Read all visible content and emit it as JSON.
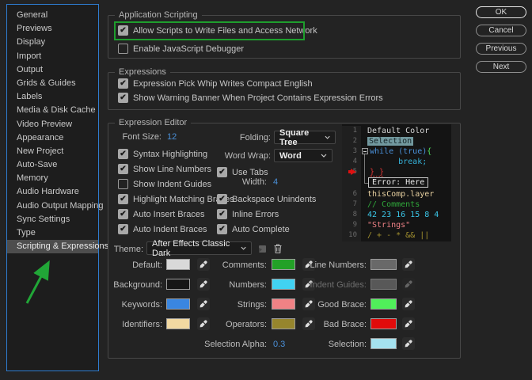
{
  "sidebar": {
    "items": [
      {
        "label": "General",
        "selected": false
      },
      {
        "label": "Previews",
        "selected": false
      },
      {
        "label": "Display",
        "selected": false
      },
      {
        "label": "Import",
        "selected": false
      },
      {
        "label": "Output",
        "selected": false
      },
      {
        "label": "Grids & Guides",
        "selected": false
      },
      {
        "label": "Labels",
        "selected": false
      },
      {
        "label": "Media & Disk Cache",
        "selected": false
      },
      {
        "label": "Video Preview",
        "selected": false
      },
      {
        "label": "Appearance",
        "selected": false
      },
      {
        "label": "New Project",
        "selected": false
      },
      {
        "label": "Auto-Save",
        "selected": false
      },
      {
        "label": "Memory",
        "selected": false
      },
      {
        "label": "Audio Hardware",
        "selected": false
      },
      {
        "label": "Audio Output Mapping",
        "selected": false
      },
      {
        "label": "Sync Settings",
        "selected": false
      },
      {
        "label": "Type",
        "selected": false
      },
      {
        "label": "Scripting & Expressions",
        "selected": true
      }
    ]
  },
  "dialog_buttons": {
    "ok": "OK",
    "cancel": "Cancel",
    "previous": "Previous",
    "next": "Next"
  },
  "application_scripting": {
    "title": "Application Scripting",
    "allow_scripts": {
      "label": "Allow Scripts to Write Files and Access Network",
      "checked": true
    },
    "enable_debugger": {
      "label": "Enable JavaScript Debugger",
      "checked": false
    }
  },
  "expressions": {
    "title": "Expressions",
    "pick_whip": {
      "label": "Expression Pick Whip Writes Compact English",
      "checked": true
    },
    "warning_banner": {
      "label": "Show Warning Banner When Project Contains Expression Errors",
      "checked": true
    }
  },
  "expression_editor": {
    "title": "Expression Editor",
    "font_size": {
      "label": "Font Size:",
      "value": "12"
    },
    "folding": {
      "label": "Folding:",
      "value": "Square Tree"
    },
    "word_wrap": {
      "label": "Word Wrap:",
      "value": "Word"
    },
    "tab_width": {
      "label": "Width:",
      "value": "4"
    },
    "checks": {
      "syntax_highlighting": {
        "label": "Syntax Highlighting",
        "checked": true
      },
      "show_line_numbers": {
        "label": "Show Line Numbers",
        "checked": true
      },
      "show_indent_guides": {
        "label": "Show Indent Guides",
        "checked": false
      },
      "highlight_matching_braces": {
        "label": "Highlight Matching Braces",
        "checked": true
      },
      "auto_insert_braces": {
        "label": "Auto Insert Braces",
        "checked": true
      },
      "auto_indent_braces": {
        "label": "Auto Indent Braces",
        "checked": true
      },
      "use_tabs": {
        "label": "Use Tabs",
        "checked": true
      },
      "backspace_unindents": {
        "label": "Backspace Unindents",
        "checked": true
      },
      "inline_errors": {
        "label": "Inline Errors",
        "checked": true
      },
      "auto_complete": {
        "label": "Auto Complete",
        "checked": true
      }
    },
    "preview": {
      "error_tooltip": "Error: Here",
      "lines": [
        {
          "num": "1",
          "tokens": [
            {
              "text": "Default Color",
              "color": "#d6d6d6"
            }
          ]
        },
        {
          "num": "2",
          "tokens": [
            {
              "text": "Selection",
              "color": "#152428"
            }
          ]
        },
        {
          "num": "3",
          "tokens": [
            {
              "text": "while (true)",
              "color": "#4a90d9"
            },
            {
              "text": "{",
              "color": "#4fdf5a"
            }
          ]
        },
        {
          "num": "4",
          "tokens": [
            {
              "text": "      break;",
              "color": "#35b1d8"
            }
          ]
        },
        {
          "num": "5",
          "tokens": [
            {
              "text": "} }",
              "color": "#d63333"
            }
          ]
        },
        {
          "num": "6",
          "tokens": [
            {
              "text": "thisComp.layer",
              "color": "#e6cf9f"
            }
          ]
        },
        {
          "num": "7",
          "tokens": [
            {
              "text": "// Comments",
              "color": "#2fa83a"
            }
          ]
        },
        {
          "num": "8",
          "tokens": [
            {
              "text": "42 23 16 15 8 4",
              "color": "#3bc8ea"
            }
          ]
        },
        {
          "num": "9",
          "tokens": [
            {
              "text": "\"Strings\"",
              "color": "#ee8186"
            }
          ]
        },
        {
          "num": "10",
          "tokens": [
            {
              "text": "/ + - * && ||",
              "color": "#a3912f"
            }
          ]
        }
      ]
    },
    "theme": {
      "label": "Theme:",
      "value": "After Effects Classic Dark"
    },
    "colors": {
      "default": {
        "label": "Default:",
        "hex": "#d9d9d9"
      },
      "comments": {
        "label": "Comments:",
        "hex": "#23a127"
      },
      "line_numbers": {
        "label": "Line Numbers:",
        "hex": "#696969"
      },
      "background": {
        "label": "Background:",
        "hex": "#161616"
      },
      "numbers": {
        "label": "Numbers:",
        "hex": "#41d2f2"
      },
      "indent_guides": {
        "label": "Indent Guides:",
        "hex": "#585858"
      },
      "keywords": {
        "label": "Keywords:",
        "hex": "#3a86e0"
      },
      "strings": {
        "label": "Strings:",
        "hex": "#f08285"
      },
      "good_brace": {
        "label": "Good Brace:",
        "hex": "#50ef5a"
      },
      "identifiers": {
        "label": "Identifiers:",
        "hex": "#f2d9a2"
      },
      "operators": {
        "label": "Operators:",
        "hex": "#96852d"
      },
      "bad_brace": {
        "label": "Bad Brace:",
        "hex": "#e10b0b"
      },
      "selection": {
        "label": "Selection:",
        "hex": "#a5e2ef"
      }
    },
    "selection_alpha": {
      "label": "Selection Alpha:",
      "value": "0.3"
    }
  },
  "annotations": {
    "highlight_box_color": "#1e9e2d",
    "arrow_color": "#21a637"
  }
}
